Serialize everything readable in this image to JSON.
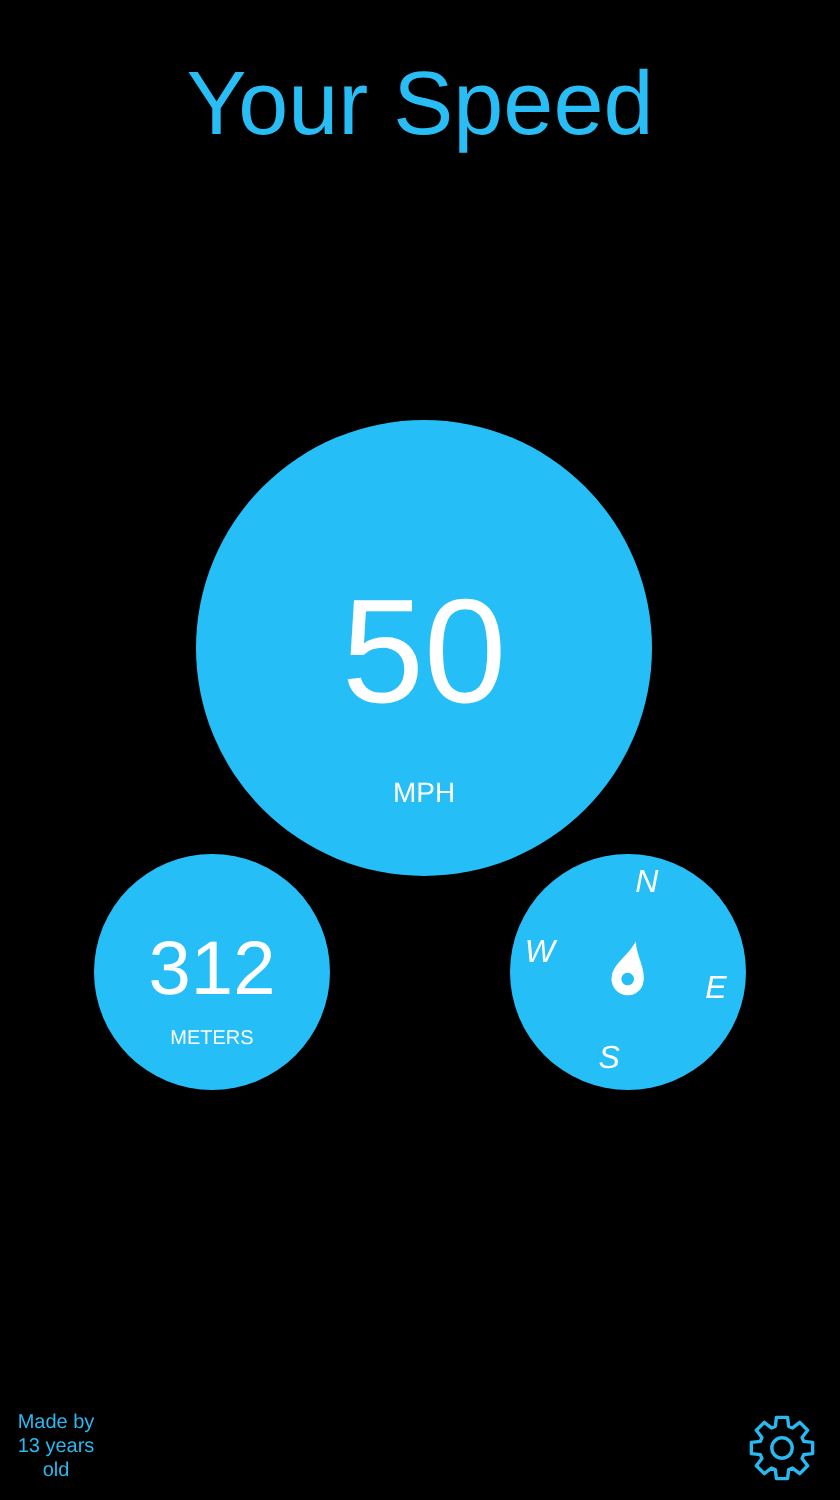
{
  "title": "Your Speed",
  "speed": {
    "value": "50",
    "unit": "MPH"
  },
  "altitude": {
    "value": "312",
    "unit": "METERS"
  },
  "compass": {
    "directions": [
      "N",
      "E",
      "S",
      "W"
    ]
  },
  "footer": {
    "credit": "Made by 13 years old"
  }
}
